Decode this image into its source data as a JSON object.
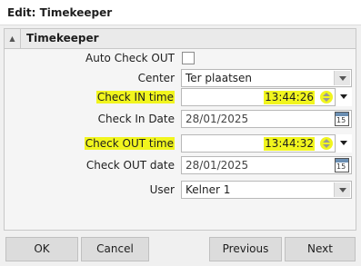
{
  "window": {
    "title": "Edit: Timekeeper"
  },
  "section": {
    "title": "Timekeeper",
    "collapse_icon": "▲"
  },
  "form": {
    "auto_check_out": {
      "label": "Auto Check OUT",
      "checked": false
    },
    "center": {
      "label": "Center",
      "value": "Ter plaatsen"
    },
    "check_in_time": {
      "label": "Check IN time",
      "value": "13:44:26"
    },
    "check_in_date": {
      "label": "Check In Date",
      "value": "28/01/2025",
      "calendar_icon": "15"
    },
    "check_out_time": {
      "label": "Check OUT time",
      "value": "13:44:32"
    },
    "check_out_date": {
      "label": "Check OUT date",
      "value": "28/01/2025",
      "calendar_icon": "15"
    },
    "user": {
      "label": "User",
      "value": "Kelner 1"
    }
  },
  "buttons": {
    "ok": "OK",
    "cancel": "Cancel",
    "previous": "Previous",
    "next": "Next"
  },
  "colors": {
    "highlight": "#f1f51e",
    "background": "#f0f0f0",
    "button": "#dcdcdc"
  }
}
